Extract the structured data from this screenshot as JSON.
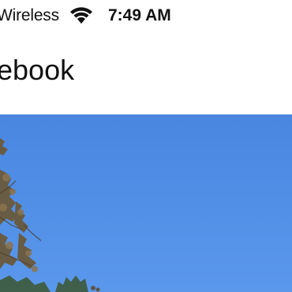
{
  "status_bar": {
    "carrier": "Wireless",
    "wifi_icon": "wifi-icon",
    "time": "7:49 AM"
  },
  "header": {
    "title": "ebook"
  },
  "photo": {
    "description_icon": "photo-image",
    "sky_color": "#4f8de6"
  }
}
